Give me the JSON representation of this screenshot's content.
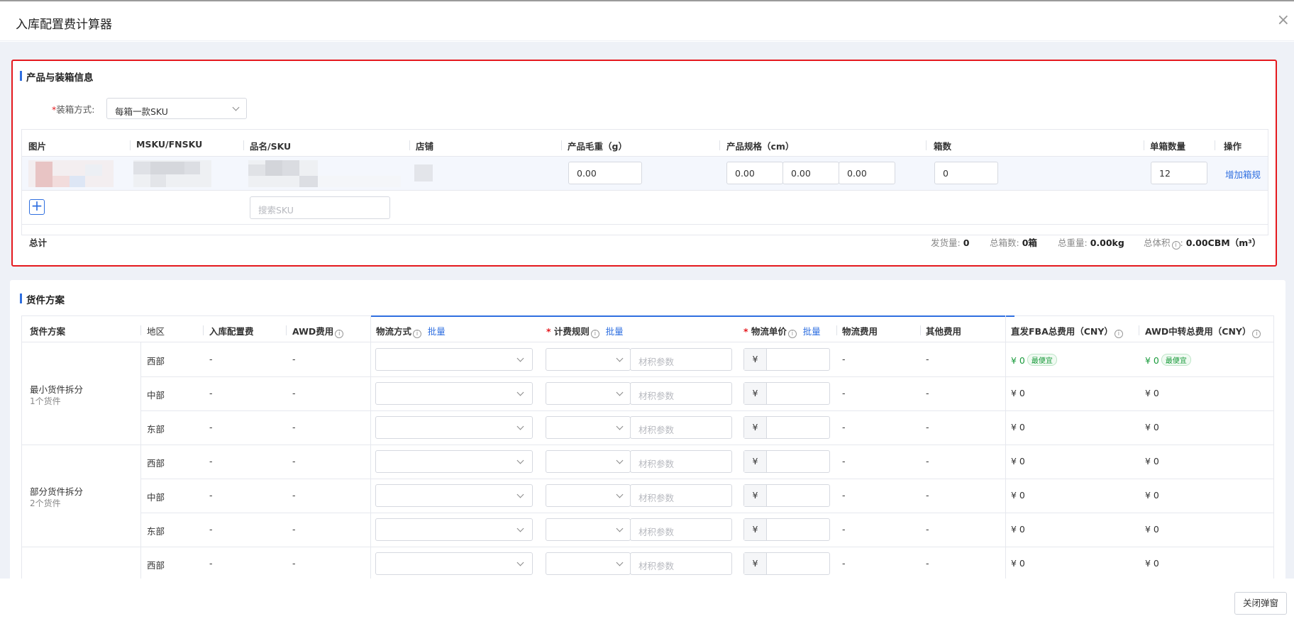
{
  "modal": {
    "title": "入库配置费计算器",
    "close_icon": "×",
    "close_button": "关闭弹窗"
  },
  "product_section": {
    "title": "产品与装箱信息",
    "packing_label": "装箱方式:",
    "packing_required": "*",
    "packing_value": "每箱一款SKU",
    "columns": [
      "图片",
      "MSKU/FNSKU",
      "品名/SKU",
      "店铺",
      "产品毛重（g）",
      "产品规格（cm）",
      "箱数",
      "单箱数量",
      "操作"
    ],
    "row": {
      "weight": "0.00",
      "length": "0.00",
      "width": "0.00",
      "height": "0.00",
      "boxes": "0",
      "qty_per_box": "12",
      "action": "增加箱规"
    },
    "search_placeholder": "搜索SKU",
    "total_label": "总计",
    "stats": {
      "ship_qty_label": "发货量:",
      "ship_qty": "0",
      "box_count_label": "总箱数:",
      "box_count": "0箱",
      "weight_label": "总重量:",
      "weight": "0.00kg",
      "volume_label": "总体积",
      "volume": "0.00CBM（m³）"
    }
  },
  "shipment_section": {
    "title": "货件方案",
    "columns": {
      "plan": "货件方案",
      "region": "地区",
      "placement_fee": "入库配置费",
      "awd_fee": "AWD费用",
      "logistics_method": "物流方式",
      "batch": "批量",
      "billing_rule": "计费规则",
      "unit_price": "物流单价",
      "logistics_fee": "物流费用",
      "other_fee": "其他费用",
      "fba_total": "直发FBA总费用（CNY）",
      "awd_total": "AWD中转总费用（CNY）"
    },
    "required_mark": "*",
    "volume_placeholder": "材积参数",
    "currency": "¥",
    "cheapest_label": "最便宜",
    "groups": [
      {
        "name": "最小货件拆分",
        "sub": "1个货件",
        "rows": [
          {
            "region": "西部",
            "placement": "-",
            "awd": "-",
            "logistics_fee": "-",
            "other_fee": "-",
            "fba_total": "¥ 0",
            "awd_total": "¥ 0",
            "cheapest": true
          },
          {
            "region": "中部",
            "placement": "-",
            "awd": "-",
            "logistics_fee": "-",
            "other_fee": "-",
            "fba_total": "¥ 0",
            "awd_total": "¥ 0",
            "cheapest": false
          },
          {
            "region": "东部",
            "placement": "-",
            "awd": "-",
            "logistics_fee": "-",
            "other_fee": "-",
            "fba_total": "¥ 0",
            "awd_total": "¥ 0",
            "cheapest": false
          }
        ]
      },
      {
        "name": "部分货件拆分",
        "sub": "2个货件",
        "rows": [
          {
            "region": "西部",
            "placement": "-",
            "awd": "-",
            "logistics_fee": "-",
            "other_fee": "-",
            "fba_total": "¥ 0",
            "awd_total": "¥ 0",
            "cheapest": false
          },
          {
            "region": "中部",
            "placement": "-",
            "awd": "-",
            "logistics_fee": "-",
            "other_fee": "-",
            "fba_total": "¥ 0",
            "awd_total": "¥ 0",
            "cheapest": false
          },
          {
            "region": "东部",
            "placement": "-",
            "awd": "-",
            "logistics_fee": "-",
            "other_fee": "-",
            "fba_total": "¥ 0",
            "awd_total": "¥ 0",
            "cheapest": false
          }
        ]
      },
      {
        "name": "",
        "sub": "",
        "rows": [
          {
            "region": "西部",
            "placement": "-",
            "awd": "-",
            "logistics_fee": "-",
            "other_fee": "-",
            "fba_total": "¥ 0",
            "awd_total": "¥ 0",
            "cheapest": false
          }
        ]
      }
    ]
  }
}
